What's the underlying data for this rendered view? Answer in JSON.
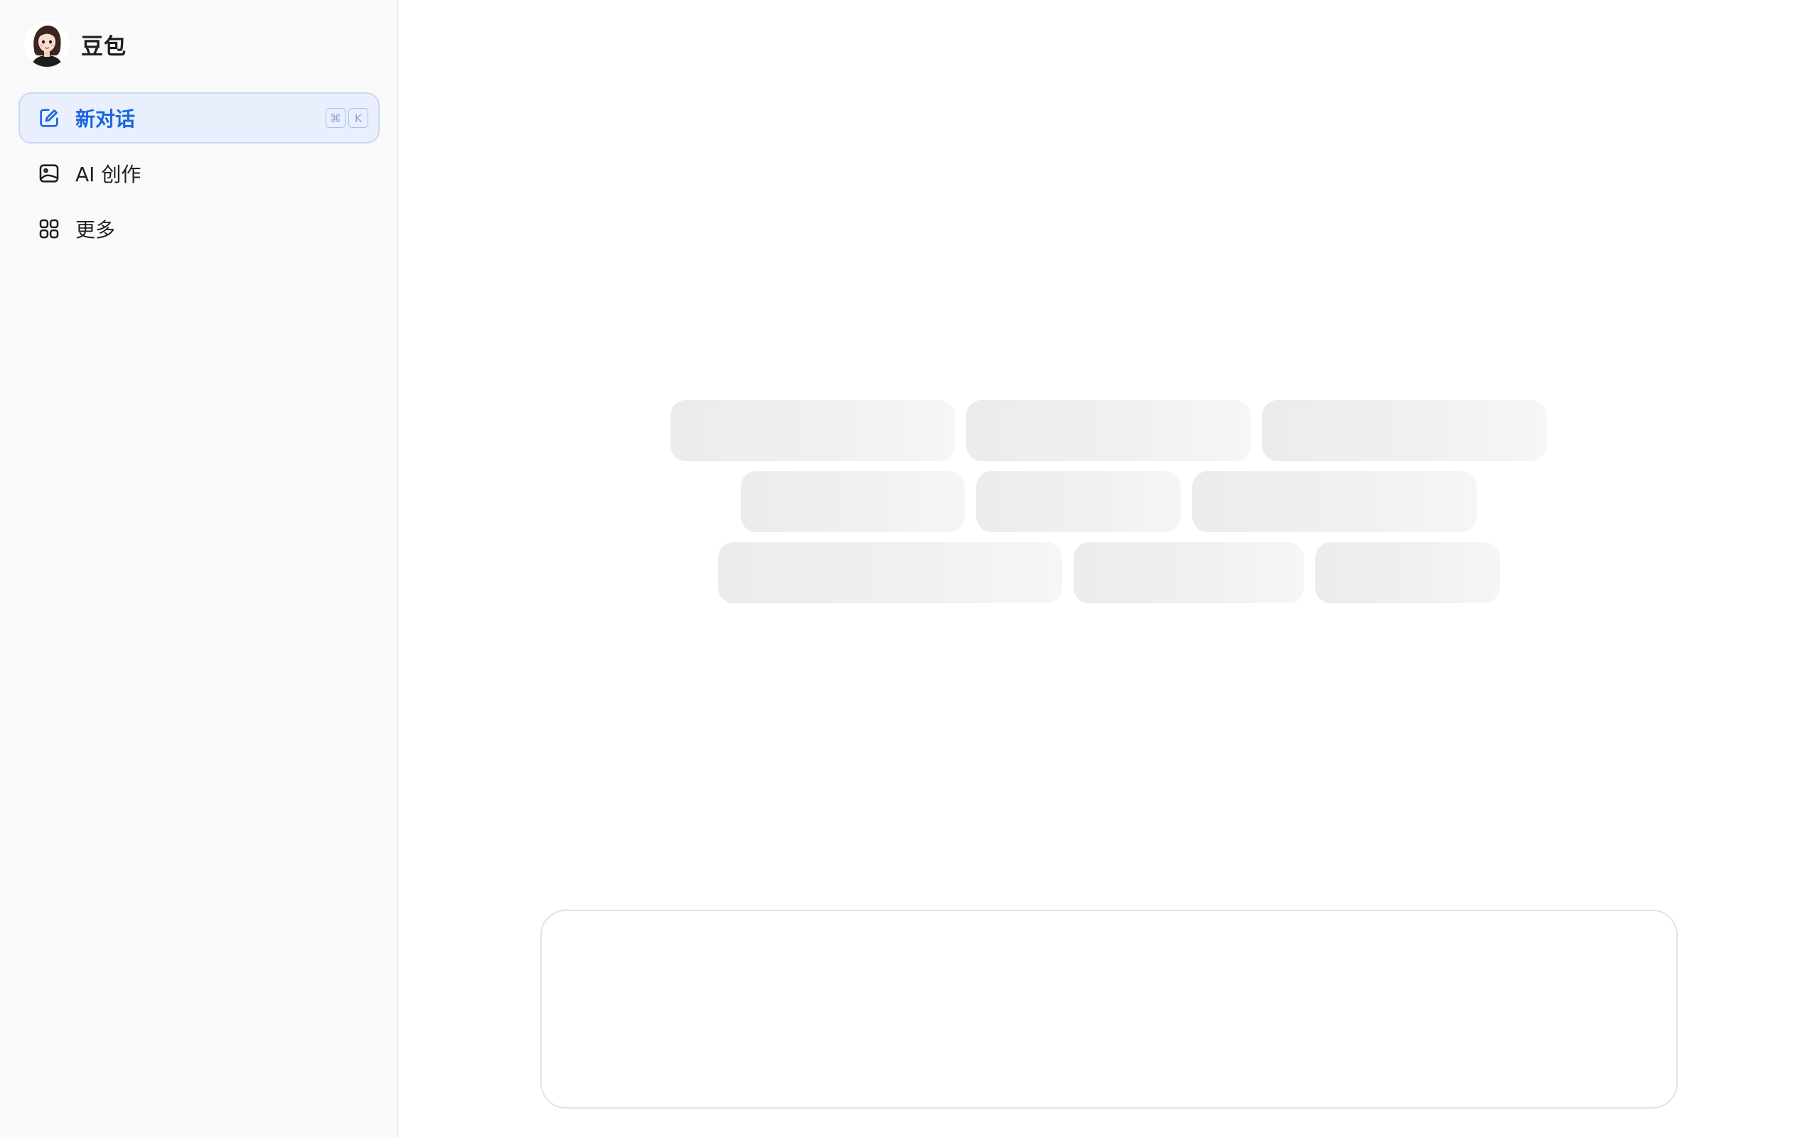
{
  "app": {
    "name": "豆包"
  },
  "sidebar": {
    "items": [
      {
        "label": "新对话",
        "icon": "edit-icon",
        "active": true,
        "shortcut": [
          "⌘",
          "K"
        ]
      },
      {
        "label": "AI 创作",
        "icon": "image-icon",
        "active": false
      },
      {
        "label": "更多",
        "icon": "grid-icon",
        "active": false
      }
    ]
  },
  "colors": {
    "accent": "#1a66e0",
    "active_bg": "#e9effc",
    "sidebar_bg": "#f9f9f9",
    "skeleton": "#ececec"
  }
}
